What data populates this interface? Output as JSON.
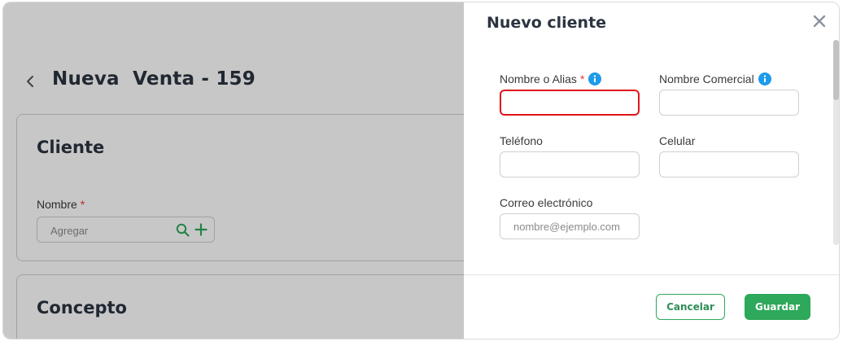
{
  "page": {
    "title": "Nueva  Venta - 159",
    "client_card": {
      "title": "Cliente",
      "name_label": "Nombre",
      "required_mark": "*",
      "name_placeholder": "Agregar"
    },
    "concept_card": {
      "title": "Concepto"
    }
  },
  "drawer": {
    "title": "Nuevo cliente",
    "fields": {
      "nombre": {
        "label": "Nombre o Alias",
        "required_mark": "*",
        "value": "",
        "placeholder": ""
      },
      "comercial": {
        "label": "Nombre Comercial",
        "value": "",
        "placeholder": ""
      },
      "telefono": {
        "label": "Teléfono",
        "value": "",
        "placeholder": ""
      },
      "celular": {
        "label": "Celular",
        "value": "",
        "placeholder": ""
      },
      "correo": {
        "label": "Correo electrónico",
        "value": "",
        "placeholder": "nombre@ejemplo.com"
      }
    },
    "buttons": {
      "cancel": "Cancelar",
      "save": "Guardar"
    }
  },
  "icons": {
    "back": "chevron-left-icon",
    "search": "search-icon",
    "add": "plus-icon",
    "info": "info-icon",
    "close": "close-icon"
  },
  "colors": {
    "accent": "#2ea85a",
    "info": "#1e9be9",
    "error": "#e0141b",
    "required": "#e53935"
  }
}
